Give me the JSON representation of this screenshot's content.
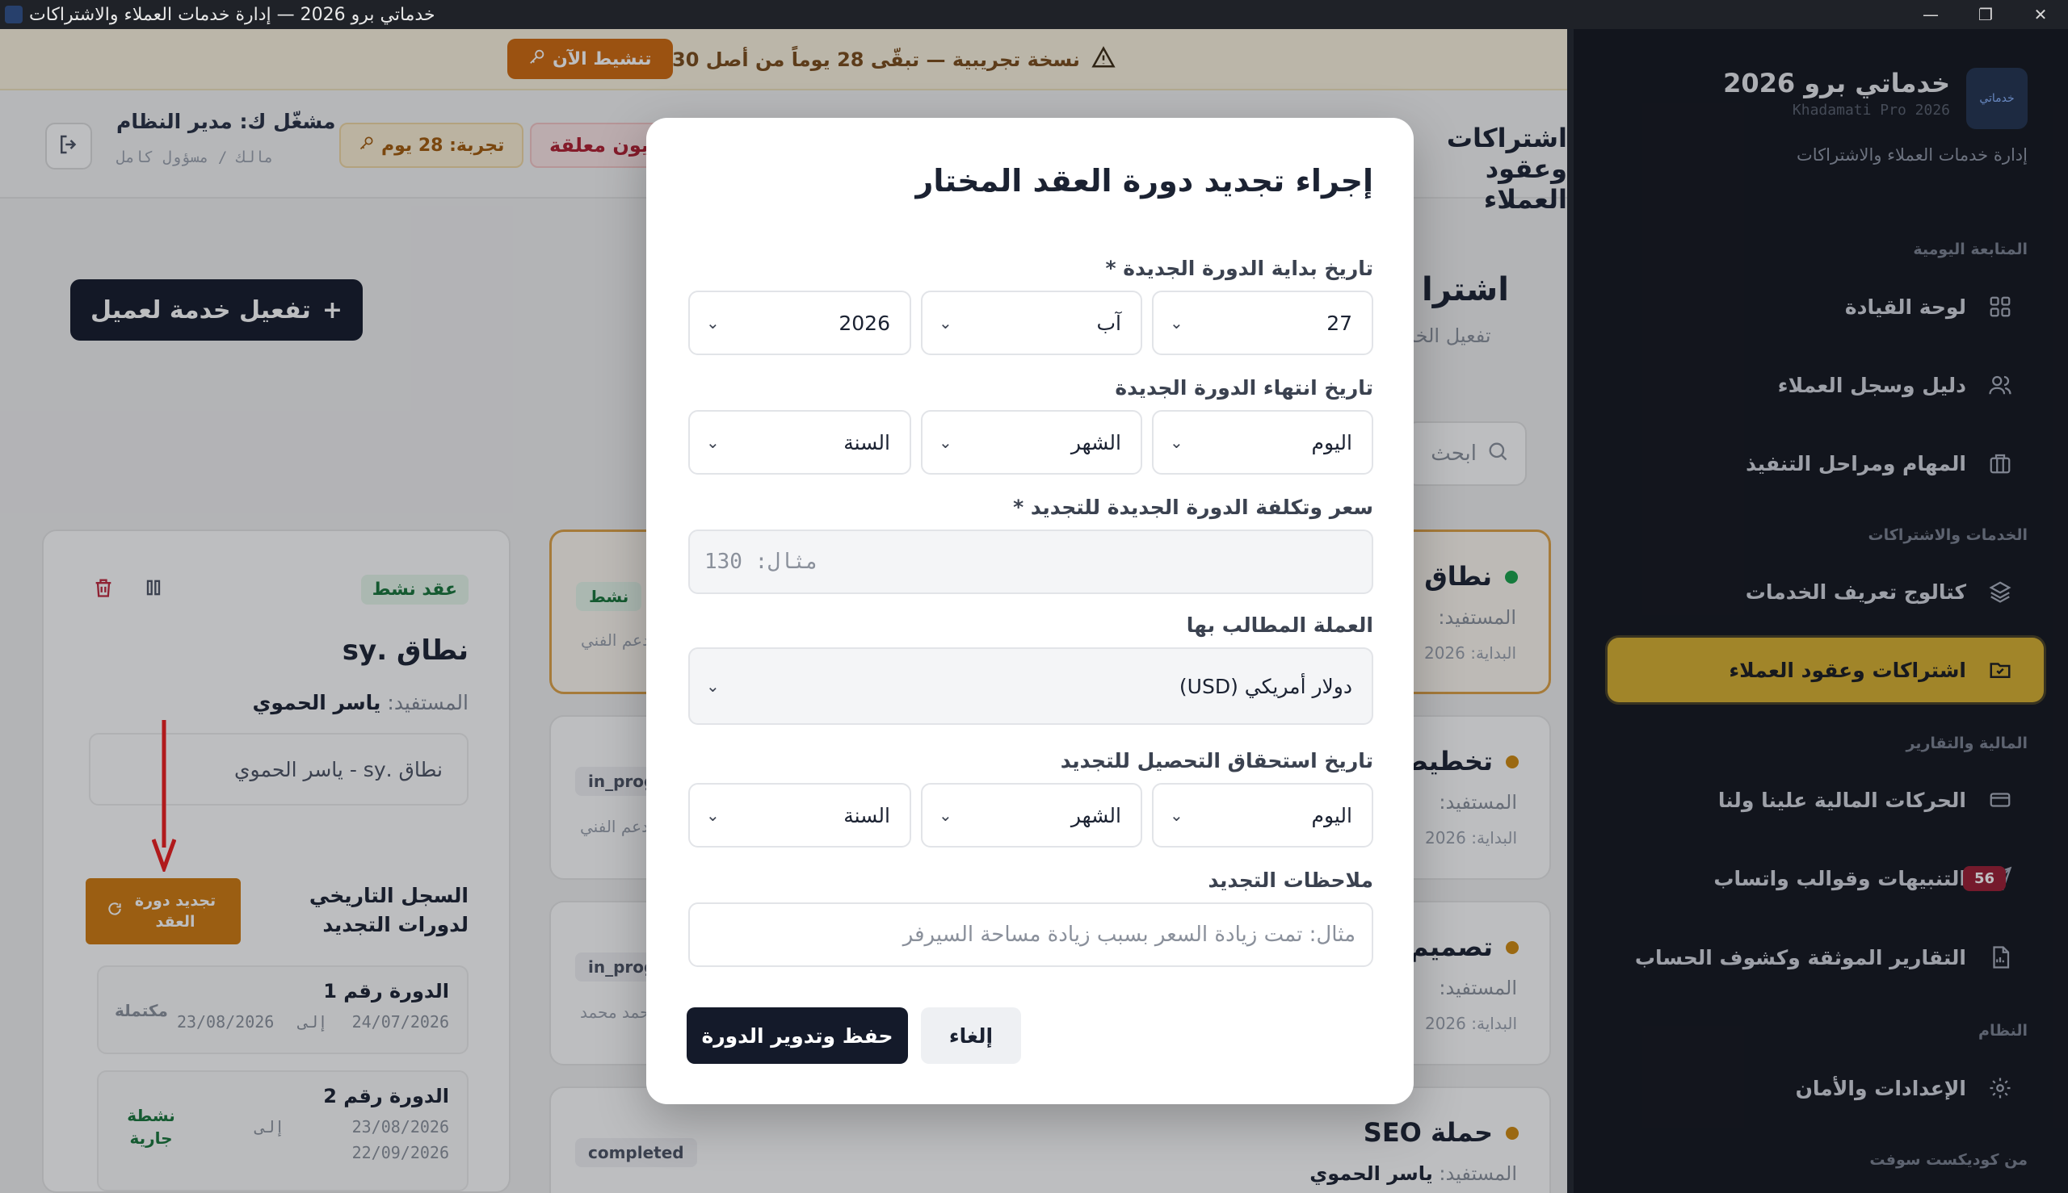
{
  "window": {
    "title": "خدماتي برو 2026 — إدارة خدمات العملاء والاشتراكات",
    "minimize": "—",
    "maximize": "❐",
    "close": "✕"
  },
  "trial_banner": {
    "text": "نسخة تجريبية — تبقّى 28 يوماً من أصل 30",
    "activate_label": "تنشيط الآن"
  },
  "header": {
    "page_title": "اشتراكات وعقود العملاء",
    "debts_label": "ديون معلقة",
    "trial_label": "تجربة: 28 يوم",
    "user_name": "مشغّل ك: مدير النظام",
    "user_role": "مالك / مسؤول كامل"
  },
  "sidebar": {
    "brand_title": "خدماتي برو 2026",
    "brand_sub": "Khadamati Pro 2026",
    "brand_logo_text": "خدماتي",
    "brand_desc": "إدارة خدمات العملاء والاشتراكات",
    "sections": [
      {
        "label": "المتابعة اليومية"
      },
      {
        "label": "الخدمات والاشتراكات"
      },
      {
        "label": "المالية والتقارير"
      },
      {
        "label": "النظام"
      },
      {
        "label": "من كوديكست سوفت"
      }
    ],
    "items": [
      {
        "label": "لوحة القيادة",
        "icon": "dashboard-icon"
      },
      {
        "label": "دليل وسجل العملاء",
        "icon": "users-icon"
      },
      {
        "label": "المهام ومراحل التنفيذ",
        "icon": "briefcase-icon"
      },
      {
        "label": "كتالوج تعريف الخدمات",
        "icon": "layers-icon"
      },
      {
        "label": "اشتراكات وعقود العملاء",
        "icon": "folder-check-icon",
        "active": true
      },
      {
        "label": "الحركات المالية علينا ولنا",
        "icon": "card-icon"
      },
      {
        "label": "التنبيهات وقوالب واتساب",
        "icon": "send-icon",
        "badge": "56"
      },
      {
        "label": "التقارير الموثقة وكشوف الحساب",
        "icon": "report-icon"
      },
      {
        "label": "الإعدادات والأمان",
        "icon": "gear-icon"
      }
    ]
  },
  "main": {
    "activate_button": "تفعيل خدمة لعميل",
    "title": "اشترا",
    "subtitle": "تفعيل الخد",
    "search_placeholder": "ابحث"
  },
  "left_card": {
    "status": "عقد نشط",
    "title": "نطاق .sy",
    "beneficiary_label": "المستفيد:",
    "beneficiary": "ياسر الحموي",
    "selector_value": "نطاق .sy - ياسر الحموي",
    "history_title": "السجل التاريخي لدورات التجديد",
    "renew_button": "تجديد دورة العقد",
    "cycles": [
      {
        "name": "الدورة رقم 1",
        "from": "24/07/2026",
        "to_word": "إلى",
        "to": "23/08/2026",
        "state": "مكتملة"
      },
      {
        "name": "الدورة رقم 2",
        "from": "23/08/2026",
        "to_word": "إلى",
        "to": "22/09/2026",
        "state": "نشطة جارية"
      }
    ]
  },
  "mid_cards": [
    {
      "title": "نطاق",
      "status": "نشط",
      "benef": "المستفيد:",
      "start": "البداية: 2026",
      "sub": "دعم الفني"
    },
    {
      "title": "تخطيط",
      "status": "in_progress",
      "benef": "المستفيد:",
      "start": "البداية: 2026",
      "sub": "دعم الفني"
    },
    {
      "title": "تصميم",
      "status": "in_progress",
      "benef": "المستفيد:",
      "start": "البداية: 2026",
      "sub": "أحمد محمد"
    },
    {
      "title": "حملة SEO",
      "status": "completed",
      "benef": "المستفيد:",
      "benef_name": "ياسر الحموي"
    }
  ],
  "modal": {
    "title": "إجراء تجديد دورة العقد المختار",
    "start_label": "تاريخ بداية الدورة الجديدة *",
    "start_day": "27",
    "start_month": "آب",
    "start_year": "2026",
    "end_label": "تاريخ انتهاء الدورة الجديدة",
    "day_ph": "اليوم",
    "month_ph": "الشهر",
    "year_ph": "السنة",
    "price_label": "سعر وتكلفة الدورة الجديدة للتجديد *",
    "price_placeholder": "مثال: 130",
    "currency_label": "العملة المطالب بها",
    "currency_value": "دولار أمريكي (USD)",
    "due_label": "تاريخ استحقاق التحصيل للتجديد",
    "notes_label": "ملاحظات التجديد",
    "notes_placeholder": "مثال: تمت زيادة السعر بسبب زيادة مساحة السيرفر",
    "save_button": "حفظ وتدوير الدورة",
    "cancel_button": "إلغاء"
  },
  "colors": {
    "accent": "#d8b12f",
    "primary": "#141a2a",
    "warning": "#d06a0d",
    "danger": "#b01e30",
    "success": "#17753a"
  }
}
